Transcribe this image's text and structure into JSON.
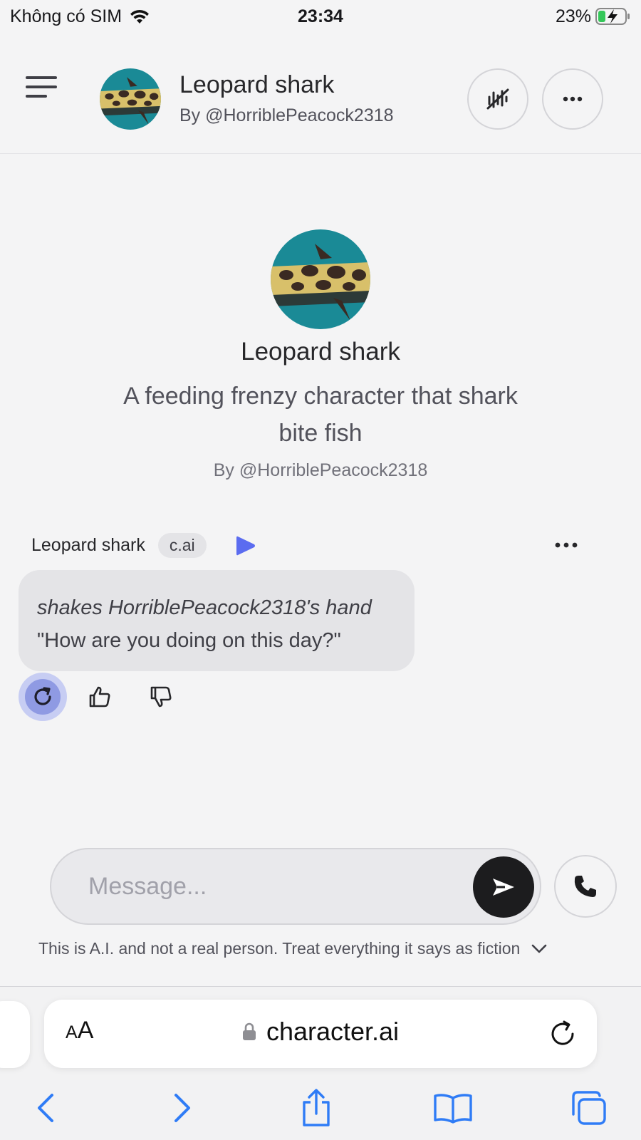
{
  "status_bar": {
    "carrier": "Không có SIM",
    "time": "23:34",
    "battery": "23%"
  },
  "header": {
    "title": "Leopard shark",
    "subtitle": "By @HorriblePeacock2318"
  },
  "profile": {
    "name": "Leopard shark",
    "description": "A feeding frenzy character that shark bite fish",
    "author": "By @HorriblePeacock2318"
  },
  "message": {
    "sender": "Leopard shark",
    "badge": "c.ai",
    "action_text": "shakes HorriblePeacock2318's hand",
    "text": "\"How are you doing on this day?\""
  },
  "composer": {
    "placeholder": "Message..."
  },
  "disclaimer": "This is A.I. and not a real person. Treat everything it says as fiction",
  "browser": {
    "aa_small": "A",
    "aa_large": "A",
    "url": "character.ai"
  },
  "colors": {
    "accent": "#5b6cf0",
    "background": "#f4f4f5",
    "bubble": "#e4e4e7",
    "ios_blue": "#2f7cf6"
  },
  "icons": {
    "menu": "hamburger-icon",
    "voice": "voice-waveform-icon",
    "more": "more-dots-icon",
    "play": "play-icon",
    "regenerate": "refresh-icon",
    "like": "thumbs-up-icon",
    "dislike": "thumbs-down-icon",
    "send": "send-icon",
    "call": "phone-icon",
    "lock": "lock-icon"
  }
}
